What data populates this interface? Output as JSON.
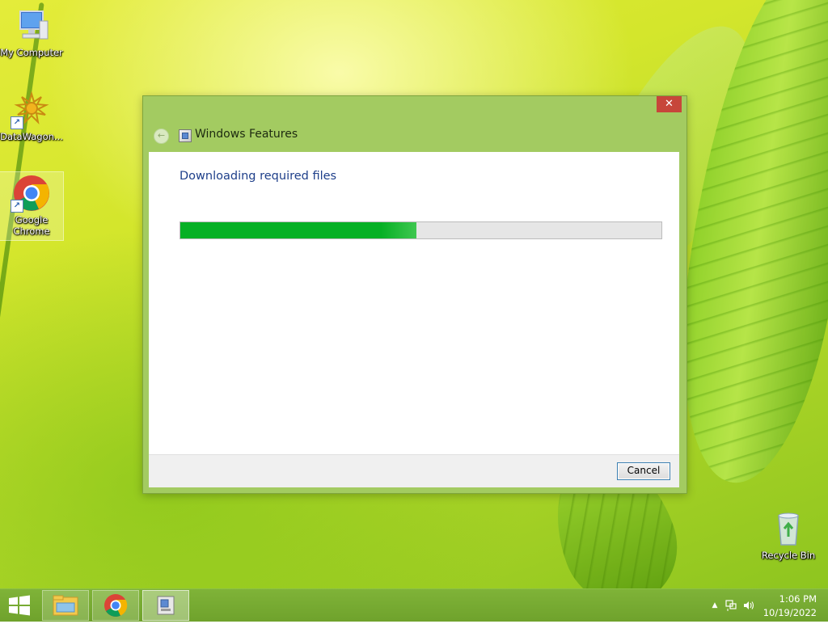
{
  "desktop": {
    "icons": [
      {
        "label": "My Computer"
      },
      {
        "label": "DataWagon..."
      },
      {
        "label": "Google Chrome"
      },
      {
        "label": "Recycle Bin"
      }
    ]
  },
  "window": {
    "title": "Windows Features",
    "close_label": "✕",
    "back_label": "←",
    "heading": "Downloading required files",
    "progress_fraction": 0.49,
    "cancel_label": "Cancel"
  },
  "taskbar": {
    "items": [
      {
        "icon": "windows-start-icon"
      },
      {
        "icon": "file-explorer-icon"
      },
      {
        "icon": "chrome-icon"
      },
      {
        "icon": "windows-features-icon"
      }
    ],
    "tray": {
      "time": "1:06 PM",
      "date": "10/19/2022",
      "chevron": "▲"
    }
  },
  "colors": {
    "window_frame": "#a3cb61",
    "close_button": "#c7463a",
    "progress_fill": "#06b025",
    "heading_text": "#1e3f8a",
    "taskbar": "#7fb338"
  }
}
